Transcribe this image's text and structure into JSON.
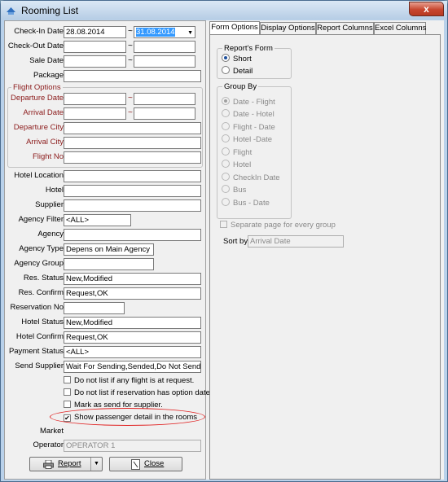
{
  "window": {
    "title": "Rooming List",
    "close_symbol": "x"
  },
  "dates": {
    "checkin_label": "Check-In Date",
    "checkin_from": "28.08.2014",
    "checkin_to": "31.08.2014",
    "checkout_label": "Check-Out Date",
    "checkout_from": "",
    "checkout_to": "",
    "sale_label": "Sale Date",
    "sale_from": "",
    "sale_to": "",
    "package_label": "Package",
    "package_value": "",
    "range_separator": "~"
  },
  "flight_options": {
    "title": "Flight Options",
    "departure_date_label": "Departure Date",
    "arrival_date_label": "Arrival Date",
    "departure_city_label": "Departure City",
    "arrival_city_label": "Arrival City",
    "flight_no_label": "Flight No"
  },
  "filters": {
    "hotel_location_label": "Hotel Location",
    "hotel_label": "Hotel",
    "supplier_label": "Supplier",
    "agency_filter_label": "Agency Filter",
    "agency_filter_value": "<ALL>",
    "agency_label": "Agency",
    "agency_type_label": "Agency Type",
    "agency_type_value": "Depens on Main Agency",
    "agency_group_label": "Agency Group",
    "res_status_label": "Res. Status",
    "res_status_value": "New,Modified",
    "res_confirm_label": "Res. Confirm",
    "res_confirm_value": "Request,OK",
    "reservation_no_label": "Reservation No",
    "hotel_status_label": "Hotel Status",
    "hotel_status_value": "New,Modified",
    "hotel_confirm_label": "Hotel Confirm",
    "hotel_confirm_value": "Request,OK",
    "payment_status_label": "Payment Status",
    "payment_status_value": "<ALL>",
    "send_supplier_label": "Send Supplier",
    "send_supplier_value": "Wait For Sending,Sended,Do Not Send"
  },
  "checkboxes": [
    {
      "label": "Do not list if any flight is at request.",
      "checked": false
    },
    {
      "label": "Do not list if reservation has option date.",
      "checked": false
    },
    {
      "label": "Mark as send for supplier.",
      "checked": false
    },
    {
      "label": "Show passenger detail in the rooms",
      "checked": true,
      "check_mark": "✔"
    }
  ],
  "market_label": "Market",
  "operator": {
    "label": "Operator",
    "value": "OPERATOR 1"
  },
  "buttons": {
    "report_label": "Report",
    "report_dropdown": "▼",
    "close_label": "Close"
  },
  "tabs": [
    {
      "label": "Form Options",
      "active": true
    },
    {
      "label": "Display Options",
      "active": false
    },
    {
      "label": "Report Columns",
      "active": false
    },
    {
      "label": "Excel Columns",
      "active": false
    }
  ],
  "reports_form": {
    "title": "Report's Form",
    "options": [
      {
        "label": "Short",
        "checked": true
      },
      {
        "label": "Detail",
        "checked": false
      }
    ]
  },
  "group_by": {
    "title": "Group By",
    "options": [
      {
        "label": "Date - Flight",
        "checked": true
      },
      {
        "label": "Date - Hotel",
        "checked": false
      },
      {
        "label": "Flight - Date",
        "checked": false
      },
      {
        "label": "Hotel -Date",
        "checked": false
      },
      {
        "label": "Flight",
        "checked": false
      },
      {
        "label": "Hotel",
        "checked": false
      },
      {
        "label": "CheckIn Date",
        "checked": false
      },
      {
        "label": "Bus",
        "checked": false
      },
      {
        "label": "Bus - Date",
        "checked": false
      }
    ]
  },
  "separate_page": {
    "label": "Separate page for every group",
    "checked": false
  },
  "sort_by": {
    "label": "Sort by",
    "value": "Arrival Date"
  },
  "colors": {
    "highlight_ellipse": "#e02020",
    "selection": "#3399ff",
    "red_label": "#8b1a1a"
  },
  "icons": {
    "app": "rooming-list-app-icon",
    "report": "printer-icon",
    "close": "close-document-icon"
  }
}
